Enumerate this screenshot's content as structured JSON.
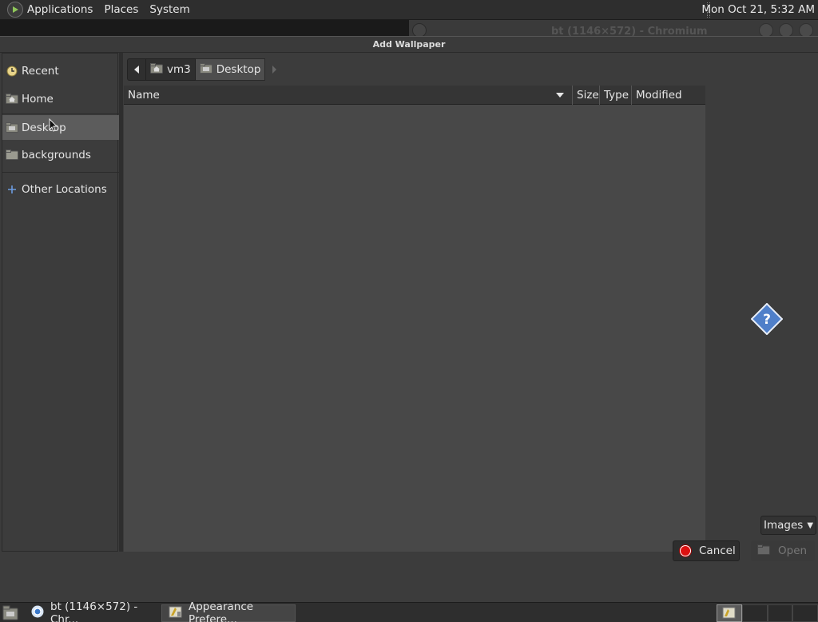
{
  "top_panel": {
    "menus": [
      "Applications",
      "Places",
      "System"
    ],
    "clock": "Mon Oct 21,  5:32 AM"
  },
  "background_window": {
    "title": "bt (1146×572) - Chromium"
  },
  "dialog": {
    "title": "Add Wallpaper",
    "sidebar": {
      "items": [
        {
          "label": "Recent",
          "icon": "recent-icon"
        },
        {
          "label": "Home",
          "icon": "home-folder-icon"
        },
        {
          "label": "Desktop",
          "icon": "desktop-folder-icon",
          "selected": true
        },
        {
          "label": "backgrounds",
          "icon": "folder-icon"
        },
        {
          "label": "Other Locations",
          "icon": "plus-icon"
        }
      ]
    },
    "pathbar": {
      "crumbs": [
        {
          "label": "vm3",
          "icon": "home-folder-icon"
        },
        {
          "label": "Desktop",
          "icon": "desktop-folder-icon",
          "active": true
        }
      ]
    },
    "file_list": {
      "columns": [
        "Name",
        "Size",
        "Type",
        "Modified"
      ],
      "rows": []
    },
    "filter": {
      "label": "Images"
    },
    "buttons": {
      "cancel": "Cancel",
      "open": "Open"
    }
  },
  "taskbar": {
    "tasks": [
      {
        "label": "bt (1146×572) - Chr...",
        "icon": "chromium-icon"
      },
      {
        "label": "Appearance Prefere...",
        "icon": "appearance-icon",
        "active": true
      }
    ],
    "workspaces": 4
  },
  "colors": {
    "selected_bg": "#5c5c5c",
    "cancel_red": "#dd1111",
    "help_blue": "#4f7fc9"
  }
}
